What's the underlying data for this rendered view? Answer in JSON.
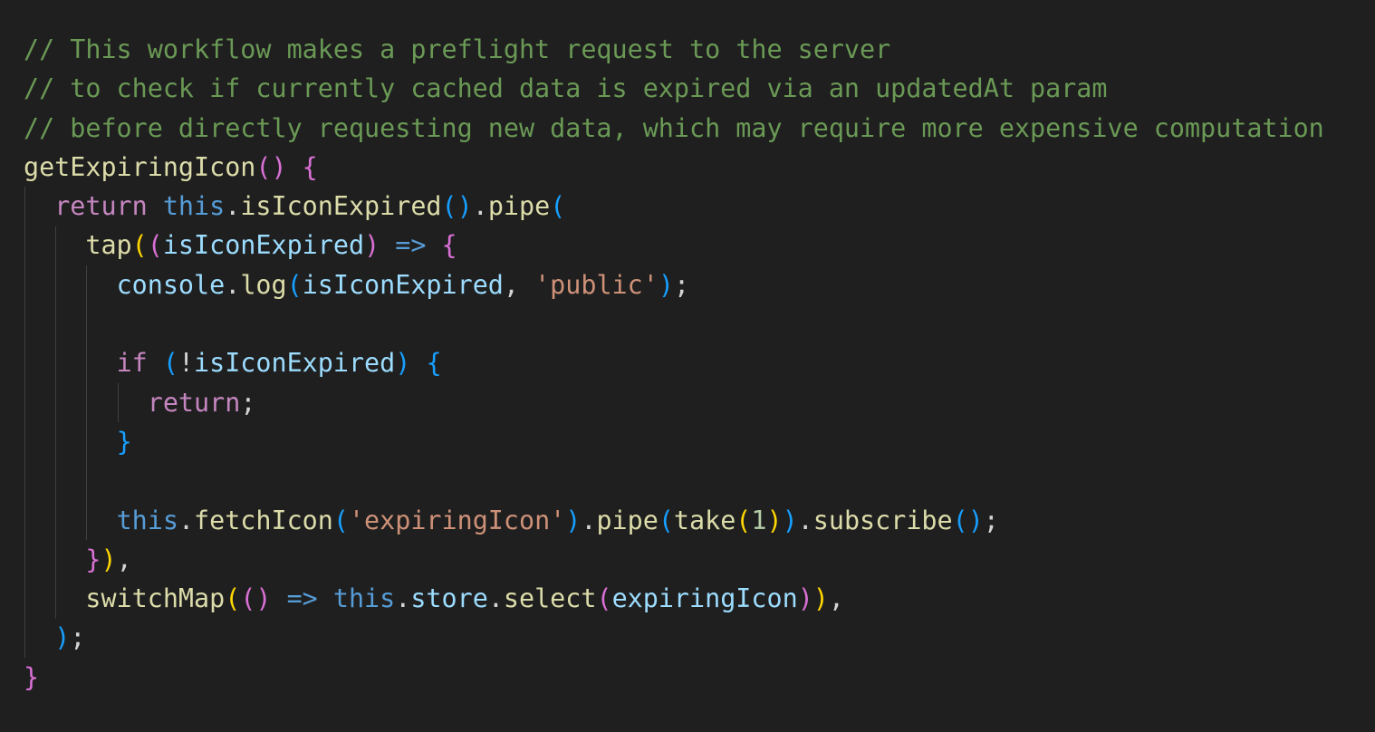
{
  "editor": {
    "language": "typescript",
    "theme": "dark",
    "lines": [
      {
        "tokens": [
          {
            "t": "// This workflow makes a preflight request to the server",
            "c": "comment"
          }
        ]
      },
      {
        "tokens": [
          {
            "t": "// to check if currently cached data is expired via an updatedAt param",
            "c": "comment"
          }
        ]
      },
      {
        "tokens": [
          {
            "t": "// before directly requesting new data, which may require more expensive computation",
            "c": "comment"
          }
        ]
      },
      {
        "tokens": [
          {
            "t": "getExpiringIcon",
            "c": "func"
          },
          {
            "t": "()",
            "c": "br-2"
          },
          {
            "t": " ",
            "c": "punct"
          },
          {
            "t": "{",
            "c": "br-2"
          }
        ]
      },
      {
        "tokens": [
          {
            "t": "  ",
            "c": "punct"
          },
          {
            "t": "return",
            "c": "keyword"
          },
          {
            "t": " ",
            "c": "punct"
          },
          {
            "t": "this",
            "c": "this"
          },
          {
            "t": ".",
            "c": "punct"
          },
          {
            "t": "isIconExpired",
            "c": "func"
          },
          {
            "t": "()",
            "c": "br-3"
          },
          {
            "t": ".",
            "c": "punct"
          },
          {
            "t": "pipe",
            "c": "func"
          },
          {
            "t": "(",
            "c": "br-3"
          }
        ]
      },
      {
        "tokens": [
          {
            "t": "    ",
            "c": "punct"
          },
          {
            "t": "tap",
            "c": "func"
          },
          {
            "t": "(",
            "c": "br-1"
          },
          {
            "t": "(",
            "c": "br-2"
          },
          {
            "t": "isIconExpired",
            "c": "var"
          },
          {
            "t": ")",
            "c": "br-2"
          },
          {
            "t": " ",
            "c": "punct"
          },
          {
            "t": "=>",
            "c": "arrow"
          },
          {
            "t": " ",
            "c": "punct"
          },
          {
            "t": "{",
            "c": "br-2"
          }
        ]
      },
      {
        "tokens": [
          {
            "t": "      ",
            "c": "punct"
          },
          {
            "t": "console",
            "c": "var"
          },
          {
            "t": ".",
            "c": "punct"
          },
          {
            "t": "log",
            "c": "func"
          },
          {
            "t": "(",
            "c": "br-3"
          },
          {
            "t": "isIconExpired",
            "c": "var"
          },
          {
            "t": ", ",
            "c": "punct"
          },
          {
            "t": "'public'",
            "c": "string"
          },
          {
            "t": ")",
            "c": "br-3"
          },
          {
            "t": ";",
            "c": "punct"
          }
        ]
      },
      {
        "tokens": [
          {
            "t": "",
            "c": "punct"
          }
        ]
      },
      {
        "tokens": [
          {
            "t": "      ",
            "c": "punct"
          },
          {
            "t": "if",
            "c": "keyword"
          },
          {
            "t": " ",
            "c": "punct"
          },
          {
            "t": "(",
            "c": "br-3"
          },
          {
            "t": "!",
            "c": "op"
          },
          {
            "t": "isIconExpired",
            "c": "var"
          },
          {
            "t": ")",
            "c": "br-3"
          },
          {
            "t": " ",
            "c": "punct"
          },
          {
            "t": "{",
            "c": "br-3"
          }
        ]
      },
      {
        "tokens": [
          {
            "t": "        ",
            "c": "punct"
          },
          {
            "t": "return",
            "c": "keyword"
          },
          {
            "t": ";",
            "c": "punct"
          }
        ]
      },
      {
        "tokens": [
          {
            "t": "      ",
            "c": "punct"
          },
          {
            "t": "}",
            "c": "br-3"
          }
        ]
      },
      {
        "tokens": [
          {
            "t": "",
            "c": "punct"
          }
        ]
      },
      {
        "tokens": [
          {
            "t": "      ",
            "c": "punct"
          },
          {
            "t": "this",
            "c": "this"
          },
          {
            "t": ".",
            "c": "punct"
          },
          {
            "t": "fetchIcon",
            "c": "func"
          },
          {
            "t": "(",
            "c": "br-3"
          },
          {
            "t": "'expiringIcon'",
            "c": "string"
          },
          {
            "t": ")",
            "c": "br-3"
          },
          {
            "t": ".",
            "c": "punct"
          },
          {
            "t": "pipe",
            "c": "func"
          },
          {
            "t": "(",
            "c": "br-3"
          },
          {
            "t": "take",
            "c": "func"
          },
          {
            "t": "(",
            "c": "br-1"
          },
          {
            "t": "1",
            "c": "number"
          },
          {
            "t": ")",
            "c": "br-1"
          },
          {
            "t": ")",
            "c": "br-3"
          },
          {
            "t": ".",
            "c": "punct"
          },
          {
            "t": "subscribe",
            "c": "func"
          },
          {
            "t": "()",
            "c": "br-3"
          },
          {
            "t": ";",
            "c": "punct"
          }
        ]
      },
      {
        "tokens": [
          {
            "t": "    ",
            "c": "punct"
          },
          {
            "t": "}",
            "c": "br-2"
          },
          {
            "t": ")",
            "c": "br-1"
          },
          {
            "t": ",",
            "c": "punct"
          }
        ]
      },
      {
        "tokens": [
          {
            "t": "    ",
            "c": "punct"
          },
          {
            "t": "switchMap",
            "c": "func"
          },
          {
            "t": "(",
            "c": "br-1"
          },
          {
            "t": "()",
            "c": "br-2"
          },
          {
            "t": " ",
            "c": "punct"
          },
          {
            "t": "=>",
            "c": "arrow"
          },
          {
            "t": " ",
            "c": "punct"
          },
          {
            "t": "this",
            "c": "this"
          },
          {
            "t": ".",
            "c": "punct"
          },
          {
            "t": "store",
            "c": "var"
          },
          {
            "t": ".",
            "c": "punct"
          },
          {
            "t": "select",
            "c": "func"
          },
          {
            "t": "(",
            "c": "br-2"
          },
          {
            "t": "expiringIcon",
            "c": "var"
          },
          {
            "t": ")",
            "c": "br-2"
          },
          {
            "t": ")",
            "c": "br-1"
          },
          {
            "t": ",",
            "c": "punct"
          }
        ]
      },
      {
        "tokens": [
          {
            "t": "  ",
            "c": "punct"
          },
          {
            "t": ")",
            "c": "br-3"
          },
          {
            "t": ";",
            "c": "punct"
          }
        ]
      },
      {
        "tokens": [
          {
            "t": "}",
            "c": "br-2"
          }
        ]
      }
    ]
  }
}
